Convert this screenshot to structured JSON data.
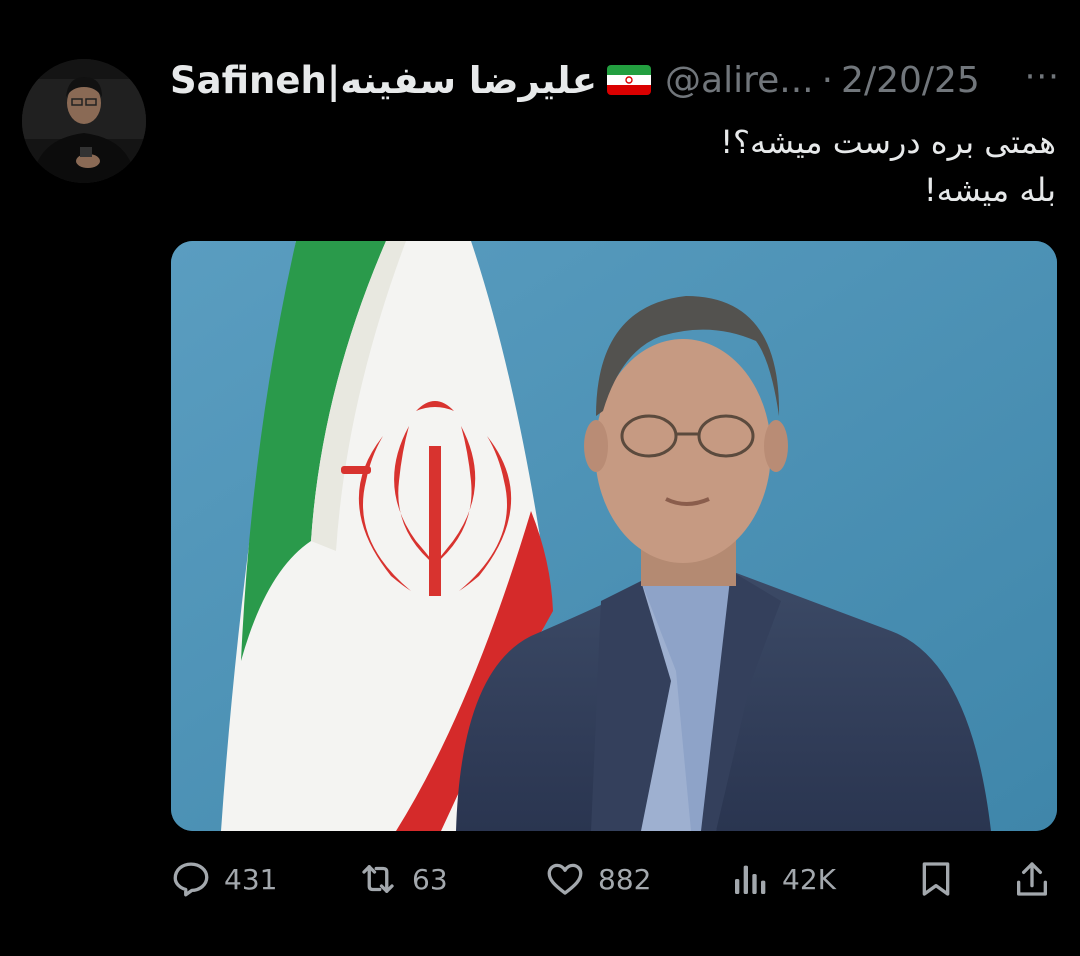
{
  "tweet": {
    "display_name": "Safineh|علیرضا سفینه",
    "handle": "@alire...",
    "separator": "·",
    "date": "2/20/25",
    "more_label": "···",
    "text_lines": [
      "همتی بره درست میشه؟!",
      "بله میشه!"
    ],
    "flag_icon": "iran-flag-icon"
  },
  "actions": {
    "replies": "431",
    "retweets": "63",
    "likes": "882",
    "views": "42K"
  },
  "colors": {
    "background": "#000000",
    "text": "#e7e9ea",
    "muted": "#71767b",
    "photo_background": "#4d93b6"
  }
}
